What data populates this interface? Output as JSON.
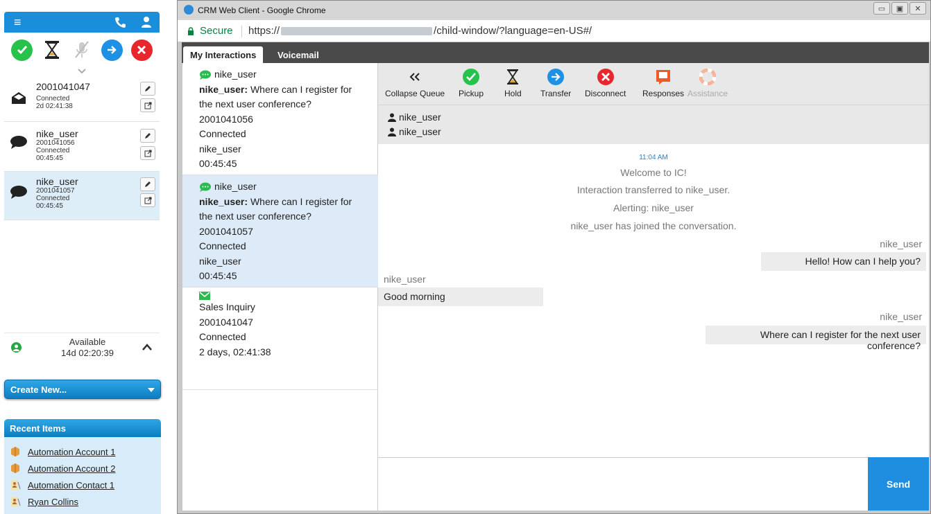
{
  "softphone": {
    "conversations": [
      {
        "title": "2001041047",
        "status": "Connected",
        "time": "2d 02:41:38"
      },
      {
        "title": "nike_user",
        "id": "2001041056",
        "status": "Connected",
        "time": "00:45:45"
      },
      {
        "title": "nike_user",
        "id": "2001041057",
        "status": "Connected",
        "time": "00:45:45"
      }
    ],
    "availability": {
      "status": "Available",
      "duration": "14d 02:20:39"
    }
  },
  "crm": {
    "create_new": "Create New...",
    "recent_title": "Recent Items",
    "recent_items": [
      "Automation Account 1",
      "Automation Account 2",
      "Automation Contact 1",
      "Ryan Collins"
    ]
  },
  "browser": {
    "title": "CRM Web Client - Google Chrome",
    "secure_label": "Secure",
    "url_prefix": "https://",
    "url_suffix": "/child-window/?language=en-US#/"
  },
  "tabs": {
    "my_interactions": "My Interactions",
    "voicemail": "Voicemail"
  },
  "queue": [
    {
      "name": "nike_user",
      "sender": "nike_user:",
      "message": "Where can I register for the next user conference?",
      "id": "2001041056",
      "status": "Connected",
      "user": "nike_user",
      "time": "00:45:45"
    },
    {
      "name": "nike_user",
      "sender": "nike_user:",
      "message": "Where can I register for the next user conference?",
      "id": "2001041057",
      "status": "Connected",
      "user": "nike_user",
      "time": "00:45:45"
    },
    {
      "subject": "Sales Inquiry",
      "id": "2001041047",
      "status": "Connected",
      "time": "2 days, 02:41:38"
    }
  ],
  "toolbar": {
    "collapse": "Collapse Queue",
    "pickup": "Pickup",
    "hold": "Hold",
    "transfer": "Transfer",
    "disconnect": "Disconnect",
    "responses": "Responses",
    "assistance": "Assistance"
  },
  "participants": [
    "nike_user",
    "nike_user"
  ],
  "transcript": {
    "timestamp": "11:04 AM",
    "system": [
      "Welcome to IC!",
      "Interaction transferred to nike_user.",
      "Alerting: nike_user",
      "nike_user has joined the conversation."
    ],
    "messages": [
      {
        "who": "nike_user",
        "text": "Hello! How can I help you?",
        "side": "right"
      },
      {
        "who": "nike_user",
        "text": "Good morning",
        "side": "left"
      },
      {
        "who": "nike_user",
        "text": "Where can I register for the next user conference?",
        "side": "right"
      }
    ]
  },
  "composer": {
    "send_label": "Send"
  },
  "colors": {
    "accent": "#1a8ddb",
    "green": "#27c24c",
    "red": "#e8262d",
    "selected": "#dcebf7"
  }
}
